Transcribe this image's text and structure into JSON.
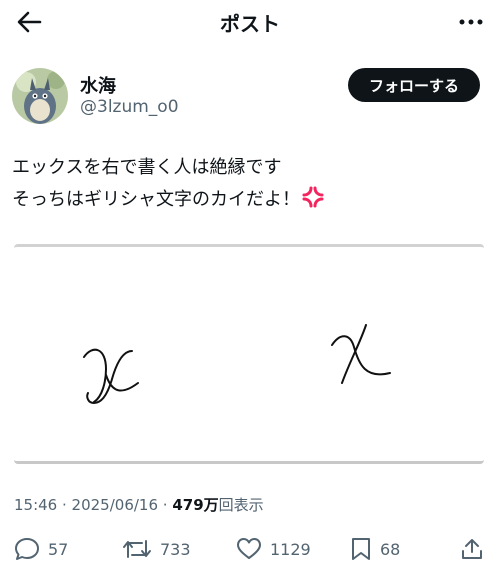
{
  "header": {
    "title": "ポスト"
  },
  "author": {
    "display_name": "水海",
    "handle": "@3lzum_o0"
  },
  "follow_label": "フォローする",
  "post": {
    "lines": [
      "エックスを右で書く人は絶縁です",
      "そっちはギリシャ文字のカイだよ！"
    ],
    "emoji": "anger-symbol"
  },
  "media": {
    "description_icons": [
      "script-x-glyph",
      "greek-chi-glyph"
    ]
  },
  "meta": {
    "time": "15:46",
    "separator1": " · ",
    "date": "2025/06/16",
    "separator2": " · ",
    "views_count": "479万",
    "views_label": "回表示"
  },
  "actions": {
    "replies": "57",
    "reposts": "733",
    "likes": "1129",
    "bookmarks": "68"
  },
  "colors": {
    "text": "#0f1419",
    "muted": "#536471",
    "accent_button": "#0f1419",
    "anger": "#f4245e"
  }
}
